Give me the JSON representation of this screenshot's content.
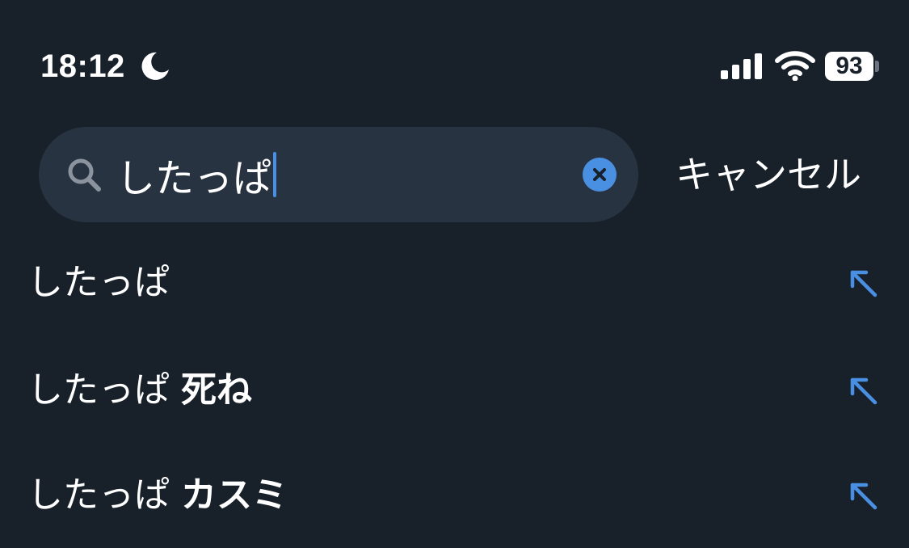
{
  "status_bar": {
    "time": "18:12",
    "focus_icon": "moon-icon",
    "signal_icon": "cellular-signal-icon",
    "wifi_icon": "wifi-icon",
    "battery_level": "93"
  },
  "search": {
    "query": "したっぱ",
    "search_icon": "search-icon",
    "clear_icon": "clear-icon",
    "cancel_label": "キャンセル",
    "accent_color": "#4a90e2"
  },
  "suggestions": [
    {
      "prefix": "したっぱ",
      "suffix": "",
      "icon": "arrow-up-left-icon"
    },
    {
      "prefix": "したっぱ ",
      "suffix": "死ね",
      "icon": "arrow-up-left-icon"
    },
    {
      "prefix": "したっぱ ",
      "suffix": "カスミ",
      "icon": "arrow-up-left-icon"
    }
  ]
}
